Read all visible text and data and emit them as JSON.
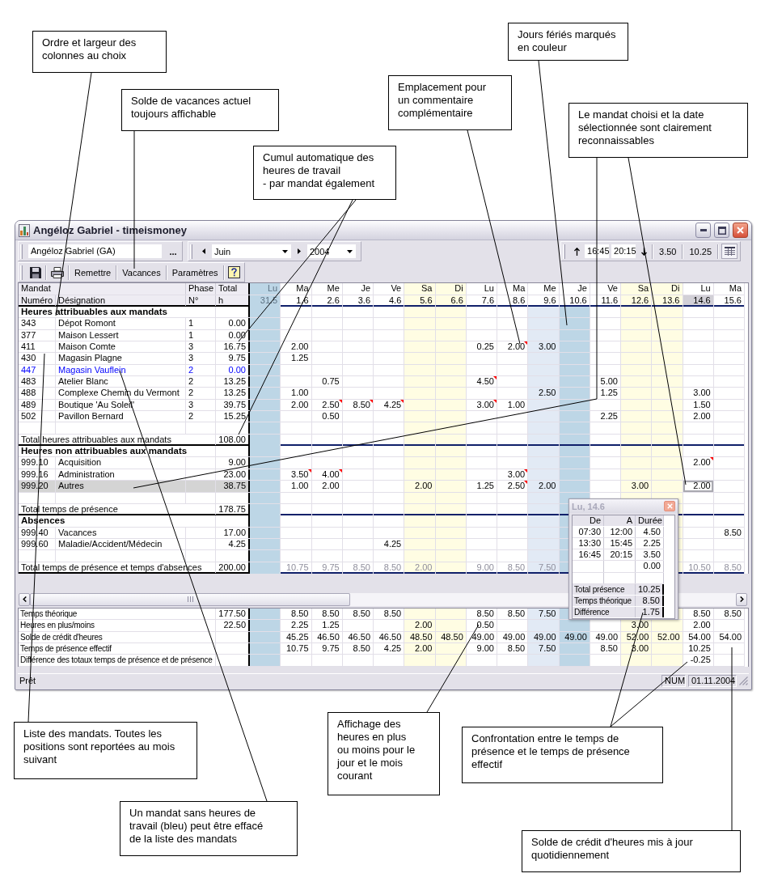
{
  "callouts_top": [
    "Ordre et largeur des\ncolonnes au choix",
    "Solde de vacances actuel\ntoujours affichable",
    "Cumul automatique des\nheures de travail\n- par mandat également",
    "Emplacement pour\nun commentaire\ncomplémentaire",
    "Jours fériés marqués\nen couleur",
    "Le mandat choisi et la date\nsélectionnée sont clairement\nreconnaissables"
  ],
  "window": {
    "title": "Angéloz Gabriel - timeismoney",
    "toolbar": {
      "employee": "Angéloz Gabriel (GA)",
      "browse": "...",
      "month": "Juin",
      "year": "2004",
      "time_from": "16:45",
      "time_to": "20:15",
      "duration": "3.50",
      "day_total": "10.25",
      "buttons": [
        "Remettre",
        "Vacances",
        "Paramètres"
      ]
    },
    "grid": {
      "header": {
        "mandat": "Mandat",
        "phase": "Phase",
        "total": "Total",
        "number": "Numéro",
        "designation": "Désignation",
        "phase_no": "N°",
        "unit": "h"
      },
      "days": [
        {
          "weekday": "Lu",
          "date": "31.5",
          "kind": "holiday",
          "other_month": true,
          "selected": false
        },
        {
          "weekday": "Ma",
          "date": "1.6",
          "kind": "workday",
          "other_month": false,
          "selected": false
        },
        {
          "weekday": "Me",
          "date": "2.6",
          "kind": "workday",
          "other_month": false,
          "selected": false
        },
        {
          "weekday": "Je",
          "date": "3.6",
          "kind": "workday",
          "other_month": false,
          "selected": false
        },
        {
          "weekday": "Ve",
          "date": "4.6",
          "kind": "workday",
          "other_month": false,
          "selected": false
        },
        {
          "weekday": "Sa",
          "date": "5.6",
          "kind": "weekend",
          "other_month": false,
          "selected": false
        },
        {
          "weekday": "Di",
          "date": "6.6",
          "kind": "weekend",
          "other_month": false,
          "selected": false
        },
        {
          "weekday": "Lu",
          "date": "7.6",
          "kind": "workday",
          "other_month": false,
          "selected": false
        },
        {
          "weekday": "Ma",
          "date": "8.6",
          "kind": "workday",
          "other_month": false,
          "selected": false
        },
        {
          "weekday": "Me",
          "date": "9.6",
          "kind": "half_holiday",
          "other_month": false,
          "selected": false
        },
        {
          "weekday": "Je",
          "date": "10.6",
          "kind": "holiday",
          "other_month": false,
          "selected": false
        },
        {
          "weekday": "Ve",
          "date": "11.6",
          "kind": "workday",
          "other_month": false,
          "selected": false
        },
        {
          "weekday": "Sa",
          "date": "12.6",
          "kind": "weekend",
          "other_month": false,
          "selected": false
        },
        {
          "weekday": "Di",
          "date": "13.6",
          "kind": "weekend",
          "other_month": false,
          "selected": false
        },
        {
          "weekday": "Lu",
          "date": "14.6",
          "kind": "workday",
          "other_month": false,
          "selected": true
        },
        {
          "weekday": "Ma",
          "date": "15.6",
          "kind": "workday",
          "other_month": false,
          "selected": false
        }
      ],
      "sections": [
        {
          "title": "Heures attribuables aux mandats",
          "rows": [
            {
              "number": "343",
              "designation": "Dépot Romont",
              "phase": "1",
              "total": "0.00",
              "deletable": false,
              "selected": false
            },
            {
              "number": "377",
              "designation": "Maison Lessert",
              "phase": "1",
              "total": "0.00",
              "deletable": false,
              "selected": false
            },
            {
              "number": "411",
              "designation": "Maison Comte",
              "phase": "3",
              "total": "16.75",
              "deletable": false,
              "selected": false,
              "hours": {
                "day_1": {
                  "value": "2.00",
                  "comment": false
                },
                "day_7": {
                  "value": "0.25",
                  "comment": false
                },
                "day_8": {
                  "value": "2.00",
                  "comment": true
                },
                "day_9": {
                  "value": "3.00",
                  "comment": false
                }
              }
            },
            {
              "number": "430",
              "designation": "Magasin Plagne",
              "phase": "3",
              "total": "9.75",
              "deletable": false,
              "selected": false,
              "hours": {
                "day_1": {
                  "value": "1.25",
                  "comment": false
                }
              }
            },
            {
              "number": "447",
              "designation": "Magasin Vauflein",
              "phase": "2",
              "total": "0.00",
              "deletable": true,
              "selected": false
            },
            {
              "number": "483",
              "designation": "Atelier Blanc",
              "phase": "2",
              "total": "13.25",
              "deletable": false,
              "selected": false,
              "hours": {
                "day_2": {
                  "value": "0.75",
                  "comment": false
                },
                "day_7": {
                  "value": "4.50",
                  "comment": true
                },
                "day_11": {
                  "value": "5.00",
                  "comment": false
                }
              }
            },
            {
              "number": "488",
              "designation": "Complexe Chemin du Vermont",
              "phase": "2",
              "total": "13.25",
              "deletable": false,
              "selected": false,
              "hours": {
                "day_1": {
                  "value": "1.00",
                  "comment": false
                },
                "day_9": {
                  "value": "2.50",
                  "comment": false
                },
                "day_11": {
                  "value": "1.25",
                  "comment": false
                },
                "day_14": {
                  "value": "3.00",
                  "comment": false
                }
              }
            },
            {
              "number": "489",
              "designation": "Boutique 'Au Soleil'",
              "phase": "3",
              "total": "39.75",
              "deletable": false,
              "selected": false,
              "hours": {
                "day_1": {
                  "value": "2.00",
                  "comment": false
                },
                "day_2": {
                  "value": "2.50",
                  "comment": true
                },
                "day_3": {
                  "value": "8.50",
                  "comment": true
                },
                "day_4": {
                  "value": "4.25",
                  "comment": true
                },
                "day_7": {
                  "value": "3.00",
                  "comment": true
                },
                "day_8": {
                  "value": "1.00",
                  "comment": false
                },
                "day_14": {
                  "value": "1.50",
                  "comment": false
                }
              }
            },
            {
              "number": "502",
              "designation": "Pavillon Bernard",
              "phase": "2",
              "total": "15.25",
              "deletable": false,
              "selected": false,
              "hours": {
                "day_2": {
                  "value": "0.50",
                  "comment": false
                },
                "day_11": {
                  "value": "2.25",
                  "comment": false
                },
                "day_14": {
                  "value": "2.00",
                  "comment": false
                }
              }
            }
          ],
          "total": {
            "label": "Total heures attribuables aux mandats",
            "value": "108.00"
          }
        },
        {
          "title": "Heures non attribuables aux mandats",
          "rows": [
            {
              "number": "999.10",
              "designation": "Acquisition",
              "total": "9.00",
              "deletable": false,
              "selected": false,
              "hours": {
                "day_14": {
                  "value": "2.00",
                  "comment": true
                }
              }
            },
            {
              "number": "999.16",
              "designation": "Administration",
              "total": "23.00",
              "deletable": false,
              "selected": false,
              "hours": {
                "day_1": {
                  "value": "3.50",
                  "comment": true
                },
                "day_2": {
                  "value": "4.00",
                  "comment": true
                },
                "day_8": {
                  "value": "3.00",
                  "comment": true
                }
              }
            },
            {
              "number": "999.20",
              "designation": "Autres",
              "total": "38.75",
              "deletable": false,
              "selected": true,
              "hours": {
                "day_1": {
                  "value": "1.00",
                  "comment": false
                },
                "day_2": {
                  "value": "2.00",
                  "comment": false
                },
                "day_5": {
                  "value": "2.00",
                  "comment": false
                },
                "day_7": {
                  "value": "1.25",
                  "comment": false
                },
                "day_8": {
                  "value": "2.50",
                  "comment": true
                },
                "day_9": {
                  "value": "2.00",
                  "comment": false
                },
                "day_12": {
                  "value": "3.00",
                  "comment": false
                },
                "day_14": {
                  "value": "2.00",
                  "comment": false
                }
              }
            }
          ],
          "total": {
            "label": "Total temps de présence",
            "value": "178.75"
          }
        },
        {
          "title": "Absences",
          "rows": [
            {
              "number": "999.40",
              "designation": "Vacances",
              "total": "17.00",
              "deletable": false,
              "selected": false,
              "hours": {
                "day_15": {
                  "value": "8.50",
                  "comment": false
                }
              }
            },
            {
              "number": "999.60",
              "designation": "Maladie/Accident/Médecin",
              "total": "4.25",
              "deletable": false,
              "selected": false,
              "hours": {
                "day_4": {
                  "value": "4.25",
                  "comment": false
                }
              }
            }
          ],
          "total": {
            "label": "Total temps de présence et temps d'absences",
            "value": "200.00",
            "day_totals": {
              "day_1": "10.75",
              "day_2": "9.75",
              "day_3": "8.50",
              "day_4": "8.50",
              "day_5": "2.00",
              "day_7": "9.00",
              "day_8": "8.50",
              "day_9": "7.50",
              "day_14": "10.50",
              "day_15": "8.50"
            }
          }
        }
      ],
      "summary": [
        {
          "label": "Temps théorique",
          "total": "177.50",
          "values": {
            "day_1": "8.50",
            "day_2": "8.50",
            "day_3": "8.50",
            "day_4": "8.50",
            "day_7": "8.50",
            "day_8": "8.50",
            "day_9": "7.50",
            "day_14": "8.50",
            "day_15": "8.50"
          }
        },
        {
          "label": "Heures en plus/moins",
          "total": "22.50",
          "values": {
            "day_1": "2.25",
            "day_2": "1.25",
            "day_5": "2.00",
            "day_7": "0.50",
            "day_12": "3.00",
            "day_14": "2.00"
          }
        },
        {
          "label": "Solde de crédit d'heures",
          "values": {
            "day_1": "45.25",
            "day_2": "46.50",
            "day_3": "46.50",
            "day_4": "46.50",
            "day_5": "48.50",
            "day_6": "48.50",
            "day_7": "49.00",
            "day_8": "49.00",
            "day_9": "49.00",
            "day_10": "49.00",
            "day_11": "49.00",
            "day_12": "52.00",
            "day_13": "52.00",
            "day_14": "54.00",
            "day_15": "54.00"
          }
        },
        {
          "label": "Temps de présence effectif",
          "values": {
            "day_1": "10.75",
            "day_2": "9.75",
            "day_3": "8.50",
            "day_4": "4.25",
            "day_5": "2.00",
            "day_7": "9.00",
            "day_8": "8.50",
            "day_9": "7.50",
            "day_11": "8.50",
            "day_12": "3.00",
            "day_14": "10.25"
          }
        },
        {
          "label": "Différence des totaux temps de présence et de présence",
          "values": {
            "day_14": "-0.25"
          }
        }
      ]
    },
    "day_popup": {
      "title": "Lu, 14.6",
      "columns": [
        "De",
        "A",
        "Durée"
      ],
      "entries": [
        {
          "from": "07:30",
          "to": "12:00",
          "duration": "4.50"
        },
        {
          "from": "13:30",
          "to": "15:45",
          "duration": "2.25"
        },
        {
          "from": "16:45",
          "to": "20:15",
          "duration": "3.50"
        },
        {
          "duration": "0.00"
        }
      ],
      "totals": [
        {
          "label": "Total présence",
          "value": "10.25"
        },
        {
          "label": "Temps théorique",
          "value": "8.50"
        },
        {
          "label": "Différence",
          "value": "1.75"
        }
      ]
    },
    "status_bar": {
      "text": "Prêt",
      "indicator": "NUM",
      "date": "01.11.2004"
    }
  },
  "callouts_bottom": [
    "Liste des mandats. Toutes les\npositions sont reportées au mois\nsuivant",
    "Un mandat sans heures de\ntravail (bleu) peut être effacé\nde la liste des mandats",
    "Affichage des\nheures en plus\nou moins pour le\njour et le mois\ncourant",
    "Confrontation entre le temps de\nprésence et le temps de présence\neffectif",
    "Solde de crédit d'heures mis à jour\nquotidiennement"
  ]
}
